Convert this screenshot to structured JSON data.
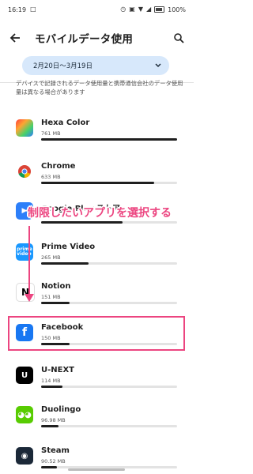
{
  "status": {
    "time": "16:19",
    "battery": "100%"
  },
  "appbar": {
    "title": "モバイルデータ使用"
  },
  "range": {
    "label": "2月20日～3月19日"
  },
  "note": {
    "text": "デバイスで記録されるデータ使用量と携帯通信会社のデータ使用量は異なる場合があります"
  },
  "apps": [
    {
      "name": "Hexa Color",
      "size": "761 MB",
      "fill": 1.0,
      "color": "#ff4f3a"
    },
    {
      "name": "Chrome",
      "size": "633 MB",
      "fill": 0.83,
      "color": "#ffffff"
    },
    {
      "name": "Google Play ストア",
      "size": "",
      "fill": 0.6,
      "color": "#2d7ff9"
    },
    {
      "name": "Prime Video",
      "size": "265 MB",
      "fill": 0.35,
      "color": "#1a98ff"
    },
    {
      "name": "Notion",
      "size": "151 MB",
      "fill": 0.2,
      "color": "#ffffff"
    },
    {
      "name": "Facebook",
      "size": "150 MB",
      "fill": 0.2,
      "color": "#1877f2"
    },
    {
      "name": "U-NEXT",
      "size": "114 MB",
      "fill": 0.15,
      "color": "#000000"
    },
    {
      "name": "Duolingo",
      "size": "96.98 MB",
      "fill": 0.13,
      "color": "#58cc02"
    },
    {
      "name": "Steam",
      "size": "90.52 MB",
      "fill": 0.12,
      "color": "#1b2838"
    }
  ],
  "callout": {
    "text": "制限したいアプリを選択する"
  },
  "colors": {
    "accent": "#ec4580",
    "rangeBg": "#d7e8fb",
    "bar": "#1f1f1f"
  }
}
